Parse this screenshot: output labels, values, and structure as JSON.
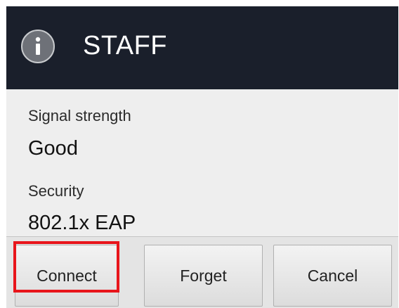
{
  "dialog": {
    "title": "STAFF",
    "icon": "info-icon",
    "fields": [
      {
        "label": "Signal strength",
        "value": "Good"
      },
      {
        "label": "Security",
        "value": "802.1x EAP"
      }
    ],
    "buttons": {
      "connect": "Connect",
      "forget": "Forget",
      "cancel": "Cancel"
    },
    "highlighted_button": "connect"
  },
  "colors": {
    "header_bg": "#1a1f2b",
    "body_bg": "#eeeeee",
    "highlight": "#e8151b"
  }
}
